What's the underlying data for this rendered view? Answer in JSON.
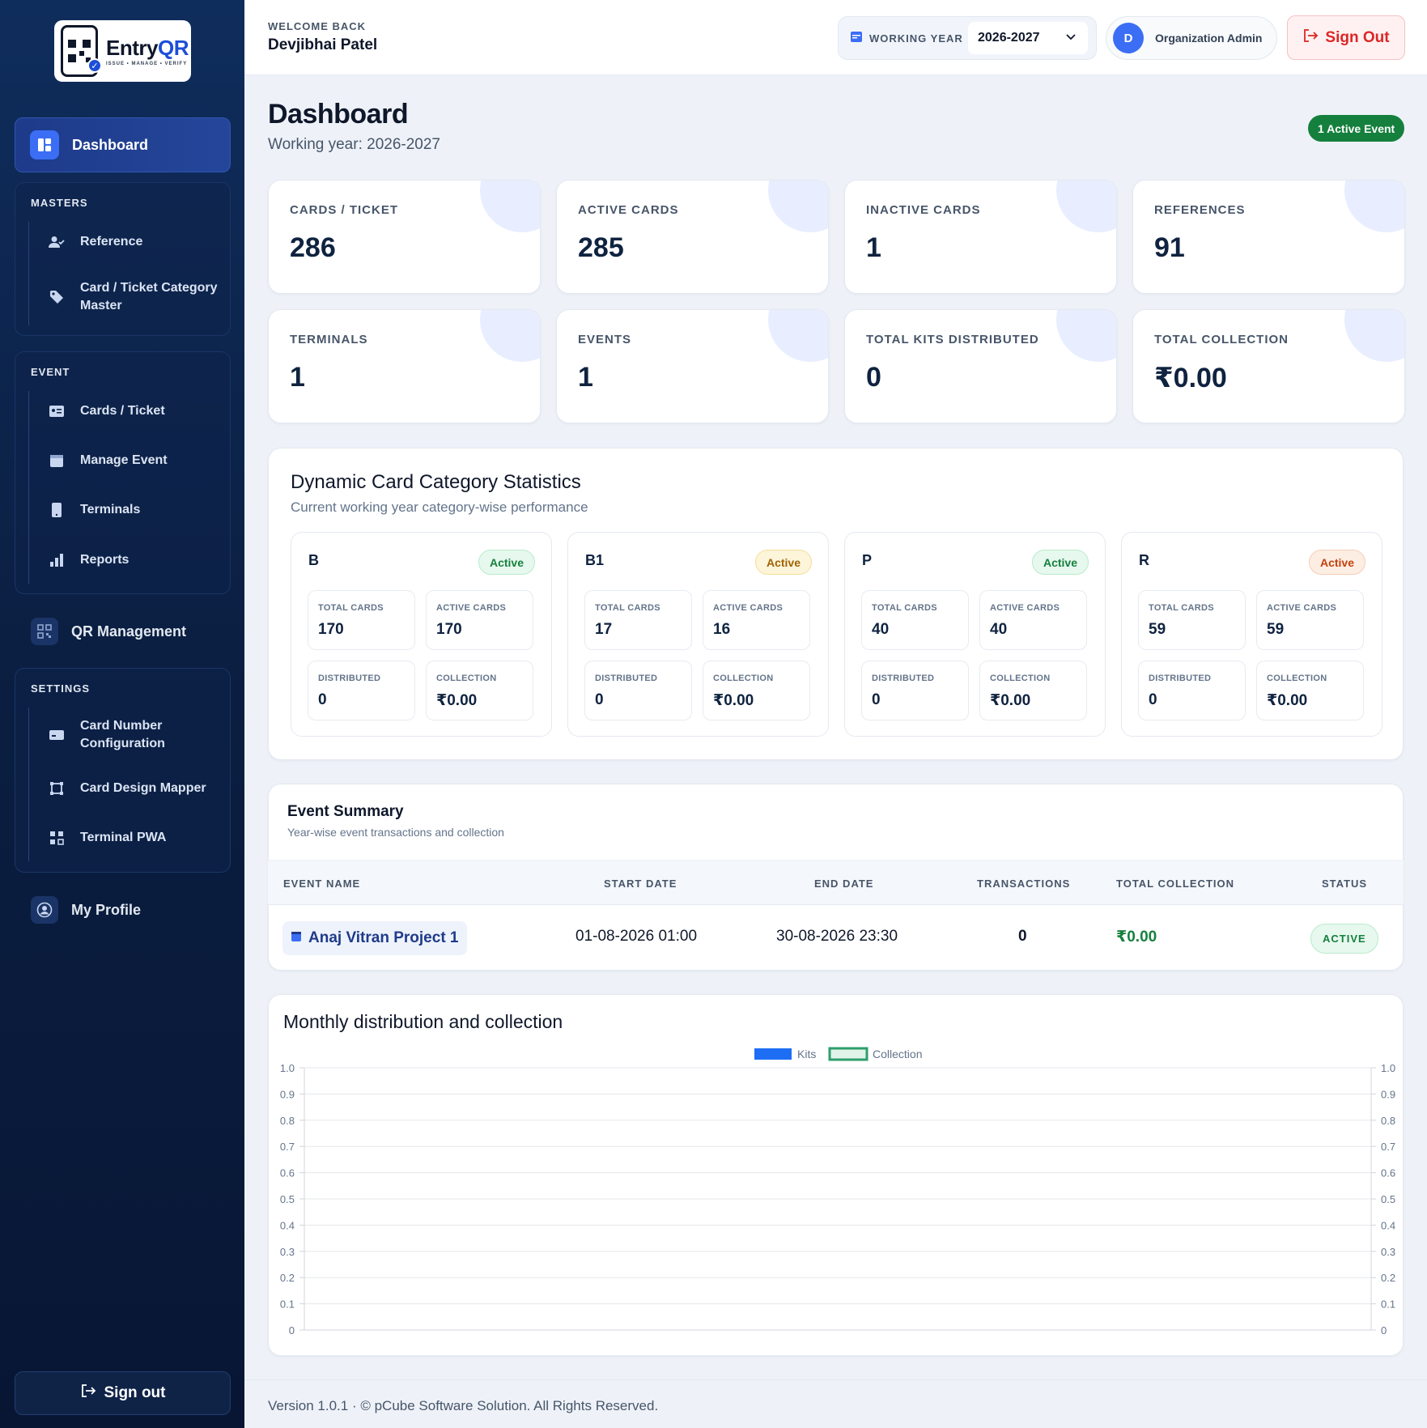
{
  "brand": {
    "name_main": "Entry",
    "name_accent": "QR",
    "tagline": "ISSUE • MANAGE • VERIFY"
  },
  "colors": {
    "sidebar_bg": "#0b1f42",
    "accent": "#3b6ef5",
    "success": "#15803d",
    "danger": "#dc2626"
  },
  "sidebar": {
    "dashboard": "Dashboard",
    "masters": {
      "title": "MASTERS",
      "items": [
        "Reference",
        "Card / Ticket Category Master"
      ]
    },
    "event": {
      "title": "EVENT",
      "items": [
        "Cards / Ticket",
        "Manage Event",
        "Terminals",
        "Reports"
      ]
    },
    "qr_management": "QR Management",
    "settings": {
      "title": "SETTINGS",
      "items": [
        "Card Number Configuration",
        "Card Design Mapper",
        "Terminal PWA"
      ]
    },
    "my_profile": "My Profile",
    "sign_out": "Sign out"
  },
  "topbar": {
    "welcome_label": "WELCOME BACK",
    "user_name": "Devjibhai Patel",
    "working_year_label": "WORKING YEAR",
    "working_year_value": "2026-2027",
    "avatar_initial": "D",
    "role": "Organization Admin",
    "sign_out": "Sign Out"
  },
  "page": {
    "title": "Dashboard",
    "subtitle": "Working year: 2026-2027",
    "active_event_badge": "1 Active Event"
  },
  "stats": [
    {
      "label": "CARDS / TICKET",
      "value": "286"
    },
    {
      "label": "ACTIVE CARDS",
      "value": "285"
    },
    {
      "label": "INACTIVE CARDS",
      "value": "1"
    },
    {
      "label": "REFERENCES",
      "value": "91"
    },
    {
      "label": "TERMINALS",
      "value": "1"
    },
    {
      "label": "EVENTS",
      "value": "1"
    },
    {
      "label": "TOTAL KITS DISTRIBUTED",
      "value": "0"
    },
    {
      "label": "TOTAL COLLECTION",
      "value": "₹0.00"
    }
  ],
  "category_stats": {
    "title": "Dynamic Card Category Statistics",
    "subtitle": "Current working year category-wise performance",
    "labels": {
      "total": "TOTAL CARDS",
      "active": "ACTIVE CARDS",
      "distributed": "DISTRIBUTED",
      "collection": "COLLECTION"
    },
    "categories": [
      {
        "name": "B",
        "status": "Active",
        "total": "170",
        "active": "170",
        "distributed": "0",
        "collection": "₹0.00"
      },
      {
        "name": "B1",
        "status": "Active",
        "total": "17",
        "active": "16",
        "distributed": "0",
        "collection": "₹0.00"
      },
      {
        "name": "P",
        "status": "Active",
        "total": "40",
        "active": "40",
        "distributed": "0",
        "collection": "₹0.00"
      },
      {
        "name": "R",
        "status": "Active",
        "total": "59",
        "active": "59",
        "distributed": "0",
        "collection": "₹0.00"
      }
    ]
  },
  "event_summary": {
    "title": "Event Summary",
    "subtitle": "Year-wise event transactions and collection",
    "columns": [
      "EVENT NAME",
      "START DATE",
      "END DATE",
      "TRANSACTIONS",
      "TOTAL COLLECTION",
      "STATUS"
    ],
    "rows": [
      {
        "name": "Anaj Vitran Project 1",
        "start": "01-08-2026 01:00",
        "end": "30-08-2026 23:30",
        "transactions": "0",
        "collection": "₹0.00",
        "status": "ACTIVE"
      }
    ]
  },
  "chart_data": {
    "type": "bar",
    "title": "Monthly distribution and collection",
    "categories": [],
    "series": [
      {
        "name": "Kits",
        "values": []
      },
      {
        "name": "Collection",
        "values": []
      }
    ],
    "ylim": [
      0,
      1.0
    ],
    "ylim_right": [
      0,
      1.0
    ],
    "yticks": [
      "0",
      "0.1",
      "0.2",
      "0.3",
      "0.4",
      "0.5",
      "0.6",
      "0.7",
      "0.8",
      "0.9",
      "1.0"
    ],
    "grid": true,
    "legend": "top-center",
    "series_colors": [
      "#1d6ef5",
      "#2e9e6b"
    ]
  },
  "footer": {
    "text": "Version 1.0.1 · © pCube Software Solution. All Rights Reserved."
  }
}
